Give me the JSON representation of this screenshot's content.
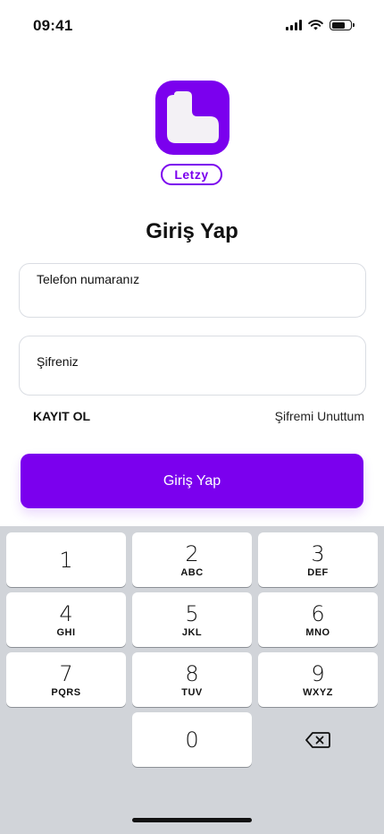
{
  "status_bar": {
    "time": "09:41",
    "icons": [
      "cellular-signal-icon",
      "wifi-icon",
      "battery-icon"
    ]
  },
  "logo": {
    "brand": "Letzy",
    "color": "#7b00ee"
  },
  "page": {
    "title": "Giriş Yap"
  },
  "form": {
    "phone_label": "Telefon numaranız",
    "phone_value": "",
    "password_label": "Şifreniz",
    "password_value": "",
    "register_link": "KAYIT OL",
    "forgot_link": "Şifremi Unuttum",
    "submit_label": "Giriş Yap"
  },
  "keyboard": {
    "keys": [
      {
        "num": "1",
        "letters": ""
      },
      {
        "num": "2",
        "letters": "ABC"
      },
      {
        "num": "3",
        "letters": "DEF"
      },
      {
        "num": "4",
        "letters": "GHI"
      },
      {
        "num": "5",
        "letters": "JKL"
      },
      {
        "num": "6",
        "letters": "MNO"
      },
      {
        "num": "7",
        "letters": "PQRS"
      },
      {
        "num": "8",
        "letters": "TUV"
      },
      {
        "num": "9",
        "letters": "WXYZ"
      },
      {
        "num": "0",
        "letters": ""
      }
    ],
    "backspace_icon": "backspace-icon"
  },
  "colors": {
    "accent": "#7b00ee",
    "keyboard_bg": "#d1d4d9"
  }
}
